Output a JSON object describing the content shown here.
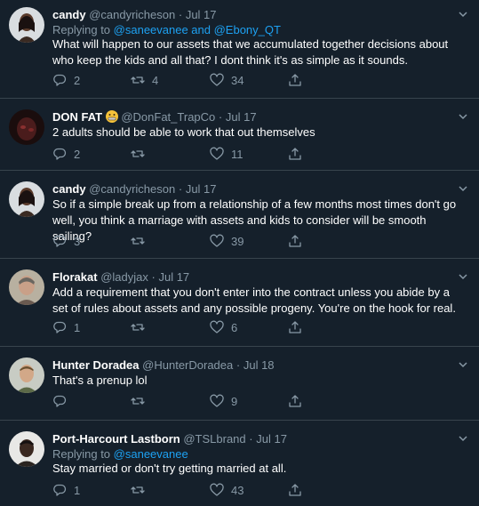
{
  "tweets": [
    {
      "name": "candy",
      "handle": "@candyricheson",
      "dot": "·",
      "date": "Jul 17",
      "replying_to_prefix": "Replying to ",
      "replying_to_mentions": "@saneevanee and @Ebony_QT",
      "text": "What will happen to our assets that we accumulated together decisions about who keep the kids and all that? I dont think it's as simple as it sounds.",
      "replies": "2",
      "retweets": "4",
      "likes": "34"
    },
    {
      "name": "DON FAT",
      "handle": "@DonFat_TrapCo",
      "dot": "·",
      "date": "Jul 17",
      "text": "2 adults should be able to work that out themselves",
      "replies": "2",
      "retweets": "",
      "likes": "11"
    },
    {
      "name": "candy",
      "handle": "@candyricheson",
      "dot": "·",
      "date": "Jul 17",
      "text": "So if a simple break up from a relationship of a few months most times don't go well, you think a marriage with assets and kids to consider will be smooth sailing?",
      "replies": "3",
      "retweets": "",
      "likes": "39"
    },
    {
      "name": "Florakat",
      "handle": "@ladyjax",
      "dot": "·",
      "date": "Jul 17",
      "text": "Add a requirement that you don't enter into the contract unless you abide by a set of rules about assets and any possible progeny.  You're on the hook for real.",
      "replies": "1",
      "retweets": "",
      "likes": "6"
    },
    {
      "name": "Hunter Doradea",
      "handle": "@HunterDoradea",
      "dot": "·",
      "date": "Jul 18",
      "text": "That's a prenup lol",
      "replies": "",
      "retweets": "",
      "likes": "9"
    },
    {
      "name": "Port-Harcourt Lastborn",
      "handle": "@TSLbrand",
      "dot": "·",
      "date": "Jul 17",
      "replying_to_prefix": "Replying to ",
      "replying_to_mentions": "@saneevanee",
      "text": "Stay married or don't try getting married at all.",
      "replies": "1",
      "retweets": "",
      "likes": "43"
    }
  ],
  "icons": {
    "reply": "reply-icon",
    "retweet": "retweet-icon",
    "like": "heart-icon",
    "share": "share-icon",
    "menu": "chevron-down-icon",
    "emoji": "grimacing-emoji-icon"
  },
  "colors": {
    "background": "#15202b",
    "text": "#ffffff",
    "muted": "#8899a6",
    "link": "#1da1f2",
    "divider": "#38444d"
  }
}
